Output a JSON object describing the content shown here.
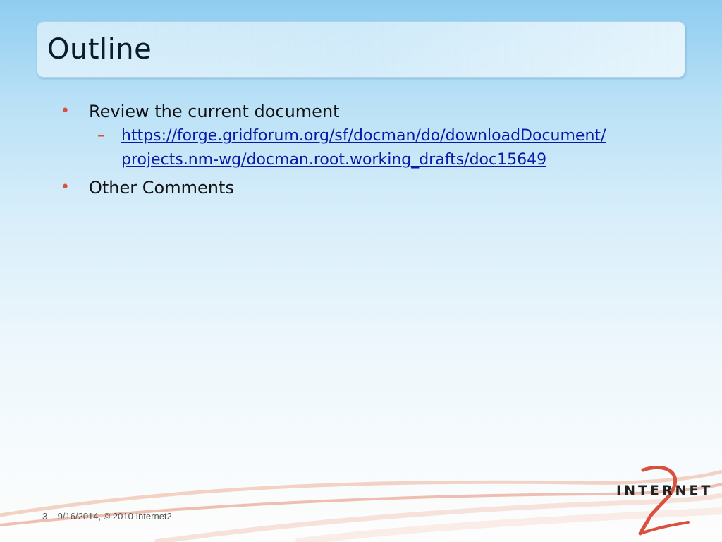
{
  "slide": {
    "title": "Outline",
    "bullets": [
      {
        "text": "Review the current document",
        "subitems": [
          {
            "link": "https://forge.gridforum.org/sf/docman/do/downloadDocument/projects.nm-wg/docman.root.working_drafts/doc15649"
          }
        ]
      },
      {
        "text": "Other Comments"
      }
    ],
    "bullet_symbol": "•",
    "sub_bullet_symbol": "–",
    "footer": "3 – 9/16/2014, © 2010 Internet2"
  },
  "logo": {
    "text": "INTERNET",
    "mark": "2",
    "icon": "internet2-logo"
  },
  "colors": {
    "bullet": "#d9503e",
    "link": "#0a1aa8",
    "title": "#0b1c2c",
    "swoosh": "#e8a58e"
  }
}
